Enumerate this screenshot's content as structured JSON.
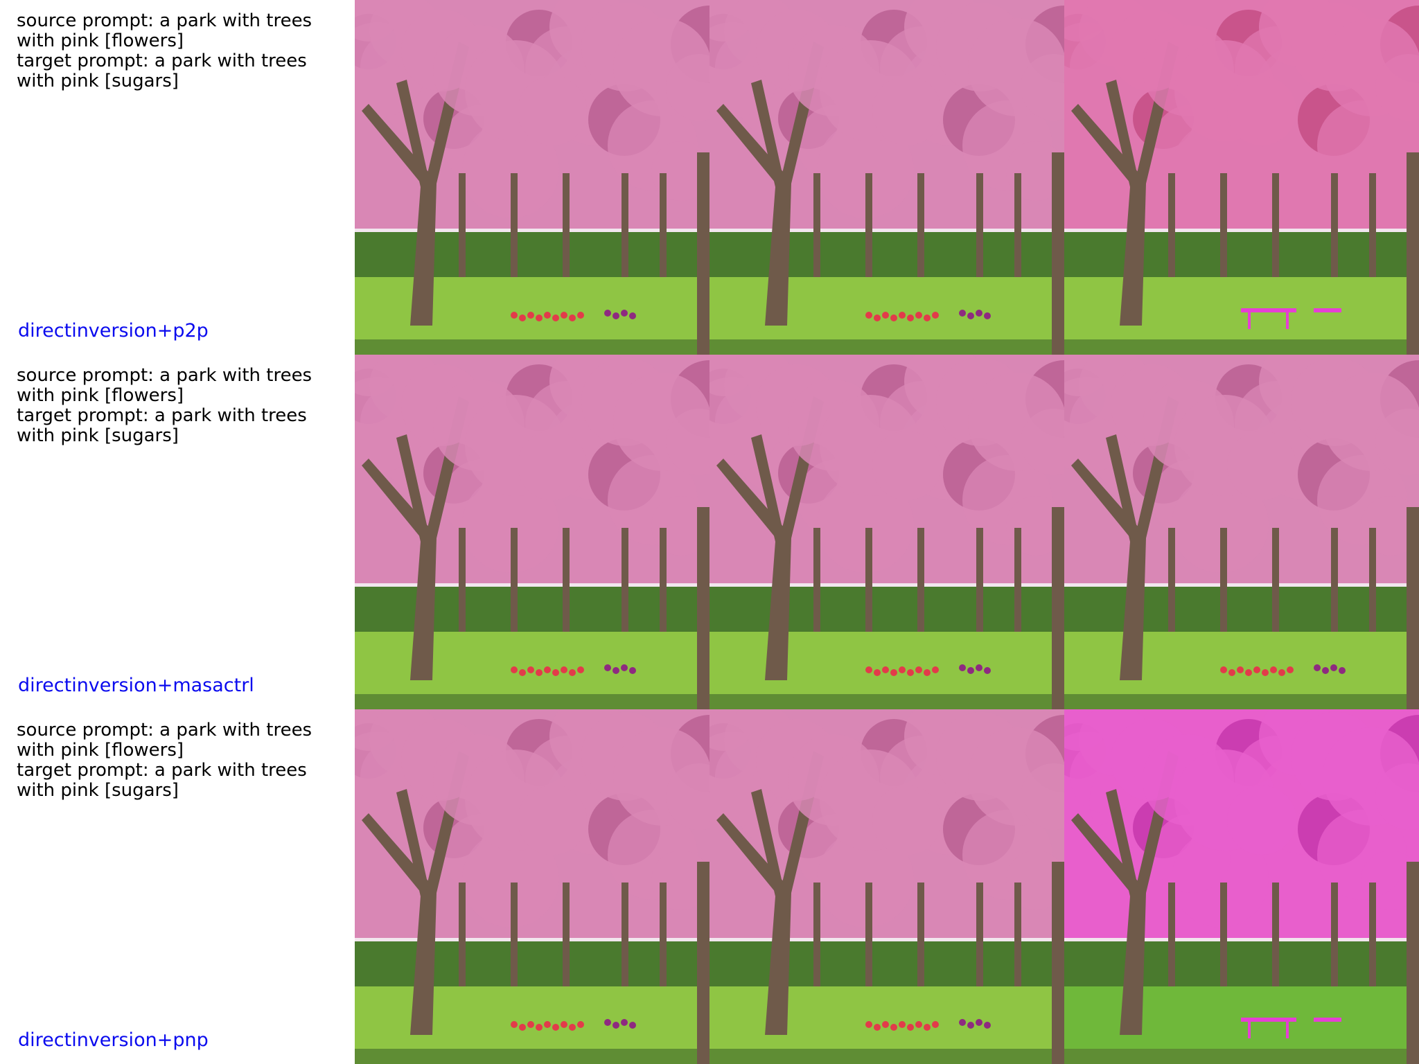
{
  "rows": [
    {
      "source_prompt": "source prompt: a park with trees with pink [flowers]",
      "target_prompt": "target prompt: a park with trees with pink [sugars]",
      "method": "directinversion+p2p",
      "edited_variant": "p2p"
    },
    {
      "source_prompt": "source prompt: a park with trees with pink [flowers]",
      "target_prompt": "target prompt: a park with trees with pink [sugars]",
      "method": "directinversion+masactrl",
      "edited_variant": "masactrl"
    },
    {
      "source_prompt": "source prompt: a park with trees with pink [flowers]",
      "target_prompt": "target prompt: a park with trees with pink [sugars]",
      "method": "directinversion+pnp",
      "edited_variant": "pnp"
    }
  ],
  "colors": {
    "method_label": "#0a0aee",
    "blossom": "#d987b5",
    "blossom_dark": "#b65b8f",
    "grass": "#8fc544",
    "hedge": "#4a7a2e",
    "trunk": "#6f5a4a"
  },
  "panel_names": [
    "source-image",
    "reconstruction-image",
    "edited-image"
  ]
}
